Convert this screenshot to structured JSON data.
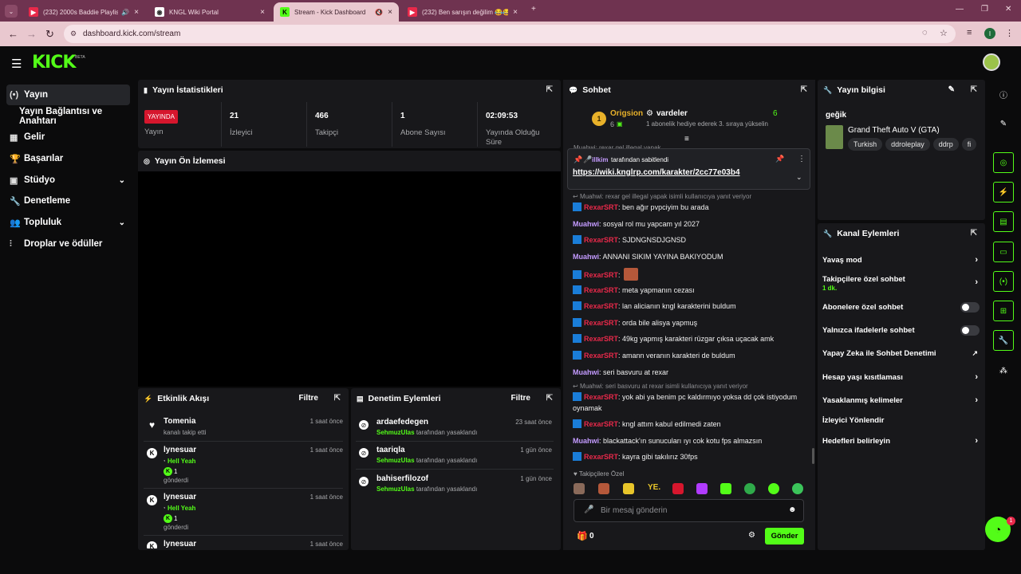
{
  "browser": {
    "tabs": [
      {
        "title": "(232) 2000s Baddie Playlist",
        "fav": "▶",
        "color": "#e8294a"
      },
      {
        "title": "KNGL Wiki Portal",
        "fav": "◉",
        "color": "#ffffff"
      },
      {
        "title": "Stream - Kick Dashboard",
        "fav": "K",
        "color": "#53fc18"
      },
      {
        "title": "(232) Ben sarışın değilim 😂😂😂",
        "fav": "▶",
        "color": "#e8294a"
      }
    ],
    "url": "dashboard.kick.com/stream",
    "profile_initial": "I"
  },
  "header": {
    "logo": "KICK",
    "logo_beta": "BETA"
  },
  "sidebar": {
    "items": [
      {
        "label": "Yayın",
        "icon": "(•)"
      },
      {
        "label": "Yayın Bağlantısı ve Anahtarı",
        "icon": ""
      },
      {
        "label": "Gelir",
        "icon": "▦"
      },
      {
        "label": "Başarılar",
        "icon": "🏆"
      },
      {
        "label": "Stüdyo",
        "icon": "▣",
        "chevron": "⌄"
      },
      {
        "label": "Denetleme",
        "icon": "🔧"
      },
      {
        "label": "Topluluk",
        "icon": "👥",
        "chevron": "⌄"
      },
      {
        "label": "Droplar ve ödüller",
        "icon": "⫶"
      }
    ]
  },
  "stats_panel": {
    "title": "Yayın İstatistikleri",
    "live_badge": "YAYINDA",
    "live_label": "Yayın",
    "stats": [
      {
        "value": "21",
        "label": "İzleyici"
      },
      {
        "value": "466",
        "label": "Takipçi"
      },
      {
        "value": "1",
        "label": "Abone Sayısı"
      },
      {
        "value": "02:09:53",
        "label": "Yayında Olduğu Süre"
      }
    ]
  },
  "preview_panel": {
    "title": "Yayın Ön İzlemesi"
  },
  "activity_panel": {
    "title": "Etkinlik Akışı",
    "filter": "Filtre",
    "events": [
      {
        "name": "Tomenia",
        "time": "1 saat önce",
        "sub": "kanalı takip etti"
      },
      {
        "name": "lynesuar",
        "time": "1 saat önce",
        "comma": ",",
        "green": "Hell Yeah",
        "count": "1",
        "sub": "gönderdi"
      },
      {
        "name": "lynesuar",
        "time": "1 saat önce",
        "comma": ",",
        "green": "Hell Yeah",
        "count": "1",
        "sub": "gönderdi"
      },
      {
        "name": "lynesuar",
        "time": "1 saat önce"
      }
    ]
  },
  "mod_panel": {
    "title": "Denetim Eylemleri",
    "filter": "Filtre",
    "actions": [
      {
        "name": "ardaefedegen",
        "time": "23 saat önce",
        "by": "SehmuzUlas",
        "suffix": "tarafından yasaklandı"
      },
      {
        "name": "taariqla",
        "time": "1 gün önce",
        "by": "SehmuzUlas",
        "suffix": "tarafından yasaklandı"
      },
      {
        "name": "bahiserfilozof",
        "time": "1 gün önce",
        "by": "SehmuzUlas",
        "suffix": "tarafından yasaklandı"
      }
    ]
  },
  "chat": {
    "title": "Sohbet",
    "gift_leader": {
      "level": "1",
      "name": "Origsion",
      "count": "6"
    },
    "gift_event": {
      "name": "vardeler",
      "count": "6",
      "text": "1 abonelik hediye ederek 3. sıraya yükselin"
    },
    "hidden_line": "Muahwi: rexar gel illegal yapak",
    "pinned": {
      "user": "illkim",
      "by": "tarafından sabitlendi",
      "link": "https://wiki.knglrp.com/karakter/2cc77e03b4"
    },
    "messages": [
      {
        "reply": "Muahwi: rexar gel illegal yapak isimli kullanıcıya yanıt veriyor"
      },
      {
        "user": "RexarSRT",
        "cls": "rx",
        "text": ": ben ağır pvpciyim bu arada"
      },
      {
        "user": "Muahwi",
        "cls": "mu",
        "text": ": sosyal rol mu yapcam yıl 2027"
      },
      {
        "user": "RexarSRT",
        "cls": "rx",
        "text": ": SJDNGNSDJGNSD"
      },
      {
        "user": "Muahwi",
        "cls": "mu",
        "text": ": ANNANI SIKIM YAYINA BAKIYODUM"
      },
      {
        "user": "RexarSRT",
        "cls": "rx",
        "text": ":"
      },
      {
        "user": "RexarSRT",
        "cls": "rx",
        "text": ": meta yapmanın cezası"
      },
      {
        "user": "RexarSRT",
        "cls": "rx",
        "text": ": lan alicianın kngl karakterini buldum"
      },
      {
        "user": "RexarSRT",
        "cls": "rx",
        "text": ": orda bile alisya yapmuş"
      },
      {
        "user": "RexarSRT",
        "cls": "rx",
        "text": ": 49kg yapmış karakteri rüzgar çıksa uçacak amk"
      },
      {
        "user": "RexarSRT",
        "cls": "rx",
        "text": ": amann veranın karakteri de buldum"
      },
      {
        "user": "Muahwi",
        "cls": "mu",
        "text": ": seri basvuru at rexar"
      },
      {
        "reply": "Muahwi: seri basvuru at rexar isimli kullanıcıya yanıt veriyor"
      },
      {
        "user": "RexarSRT",
        "cls": "rx",
        "text": ": yok abi ya benim pc kaldırmıyo yoksa dd çok istiyodum oynamak"
      },
      {
        "user": "RexarSRT",
        "cls": "rx",
        "text": ": kngl attım kabul edilmedi zaten"
      },
      {
        "user": "Muahwi",
        "cls": "mu",
        "text": ": blackattack'ın sunucuları ıyı cok kotu fps almazsın"
      },
      {
        "user": "RexarSRT",
        "cls": "rx",
        "text": ": kayra gibi takılırız 30fps"
      }
    ],
    "followers_only": "Takipçilere Özel",
    "input_placeholder": "Bir mesaj gönderin",
    "points": "0",
    "send": "Gönder"
  },
  "stream_info": {
    "title": "Yayın bilgisi",
    "stream_title": "geğik",
    "category": "Grand Theft Auto V (GTA)",
    "tags": [
      "Turkish",
      "ddroleplay",
      "ddrp",
      "fi"
    ]
  },
  "channel_actions": {
    "title": "Kanal Eylemleri",
    "items": [
      {
        "label": "Yavaş mod",
        "control": "chevron"
      },
      {
        "label": "Takipçilere özel sohbet",
        "sub": "1 dk.",
        "control": "chevron"
      },
      {
        "label": "Abonelere özel sohbet",
        "control": "toggle"
      },
      {
        "label": "Yalnızca ifadelerle sohbet",
        "control": "toggle"
      },
      {
        "label": "Yapay Zeka ile Sohbet Denetimi",
        "control": "external"
      },
      {
        "label": "Hesap yaşı kısıtlaması",
        "control": "chevron"
      },
      {
        "label": "Yasaklanmış kelimeler",
        "control": "chevron"
      },
      {
        "label": "İzleyici Yönlendir",
        "control": "none"
      },
      {
        "label": "Hedefleri belirleyin",
        "control": "chevron"
      }
    ]
  },
  "help_badge": "1",
  "colors": {
    "accent": "#53fc18",
    "live": "#d6162d",
    "panel": "#18181b"
  }
}
